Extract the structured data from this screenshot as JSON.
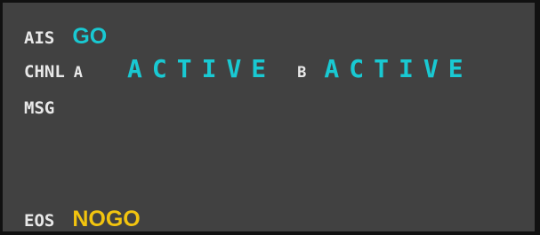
{
  "status_panel": {
    "ais": {
      "label": "AIS",
      "value": "GO"
    },
    "chnl": {
      "label": "CHNL",
      "channel_a": {
        "label": "A",
        "value": "ACTIVE"
      },
      "channel_b": {
        "label": "B",
        "value": "ACTIVE"
      }
    },
    "msg": {
      "label": "MSG",
      "value": ""
    },
    "eos": {
      "label": "EOS",
      "value": "NOGO"
    }
  },
  "colors": {
    "background": "#414141",
    "label": "#e8e8e8",
    "go_active": "#19c9d2",
    "nogo": "#f2c40f"
  }
}
